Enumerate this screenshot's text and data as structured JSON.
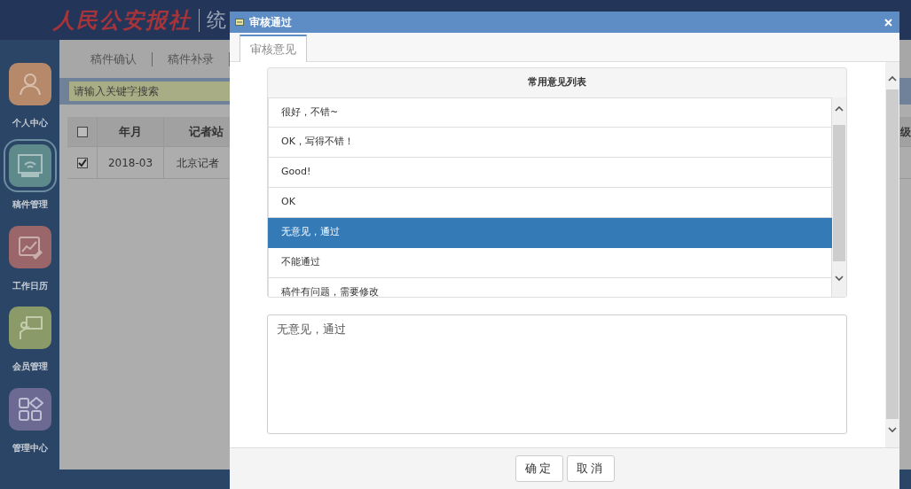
{
  "header": {
    "logo": "人民公安报社",
    "title": "统"
  },
  "sidebar": {
    "items": [
      {
        "label": "个人中心",
        "kind": "person",
        "selected": false
      },
      {
        "label": "稿件管理",
        "kind": "monitor",
        "selected": true
      },
      {
        "label": "工作日历",
        "kind": "chart",
        "selected": false
      },
      {
        "label": "会员管理",
        "kind": "presenter",
        "selected": false
      },
      {
        "label": "管理中心",
        "kind": "grid",
        "selected": false
      }
    ]
  },
  "content": {
    "tabs": [
      {
        "label": "稿件确认"
      },
      {
        "label": "稿件补录"
      }
    ],
    "search": {
      "placeholder": "请输入关键字搜索"
    },
    "table": {
      "header_checked": false,
      "columns": [
        "年月",
        "记者站"
      ],
      "column_4": "级",
      "rows": [
        {
          "checked": true,
          "cells": [
            "2018-03",
            "北京记者"
          ]
        }
      ]
    }
  },
  "dialog": {
    "title": "审核通过",
    "tabs": [
      {
        "label": "审核意见",
        "selected": true
      }
    ],
    "list": {
      "heading": "常用意见列表",
      "items": [
        {
          "text": "很好，不错~",
          "selected": false
        },
        {
          "text": "OK，写得不错！",
          "selected": false
        },
        {
          "text": "Good!",
          "selected": false
        },
        {
          "text": "OK",
          "selected": false
        },
        {
          "text": "无意见，通过",
          "selected": true
        },
        {
          "text": "不能通过",
          "selected": false
        },
        {
          "text": "稿件有问题，需要修改",
          "selected": false
        }
      ]
    },
    "comment": {
      "value": "无意见，通过"
    },
    "buttons": [
      "确定",
      "取消"
    ]
  }
}
